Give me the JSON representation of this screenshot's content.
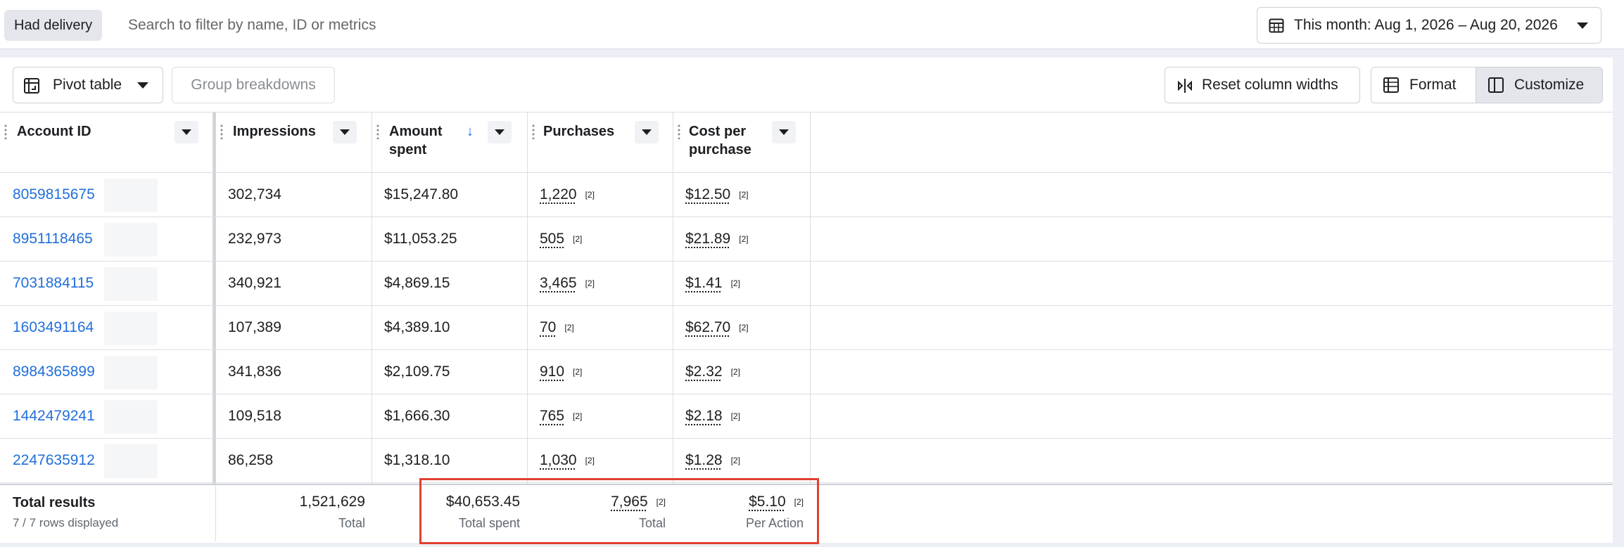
{
  "filter": {
    "chip_label": "Had delivery",
    "search_placeholder": "Search to filter by name, ID or metrics",
    "date_range": "This month: Aug 1, 2026 – Aug 20, 2026"
  },
  "toolbar": {
    "pivot_label": "Pivot table",
    "group_label": "Group breakdowns",
    "reset_label": "Reset column widths",
    "format_label": "Format",
    "customize_label": "Customize"
  },
  "table": {
    "columns": {
      "account_id": "Account ID",
      "impressions": "Impressions",
      "amount_spent_1": "Amount",
      "amount_spent_2": "spent",
      "purchases": "Purchases",
      "cost_1": "Cost per",
      "cost_2": "purchase",
      "sort_arrow": "↓"
    },
    "rows": [
      {
        "account": "8059815675",
        "impressions": "302,734",
        "spent": "$15,247.80",
        "purchases": "1,220",
        "p_fn": "[2]",
        "cost": "$12.50",
        "c_fn": "[2]"
      },
      {
        "account": "8951118465",
        "impressions": "232,973",
        "spent": "$11,053.25",
        "purchases": "505",
        "p_fn": "[2]",
        "cost": "$21.89",
        "c_fn": "[2]"
      },
      {
        "account": "7031884115",
        "impressions": "340,921",
        "spent": "$4,869.15",
        "purchases": "3,465",
        "p_fn": "[2]",
        "cost": "$1.41",
        "c_fn": "[2]"
      },
      {
        "account": "1603491164",
        "impressions": "107,389",
        "spent": "$4,389.10",
        "purchases": "70",
        "p_fn": "[2]",
        "cost": "$62.70",
        "c_fn": "[2]"
      },
      {
        "account": "8984365899",
        "impressions": "341,836",
        "spent": "$2,109.75",
        "purchases": "910",
        "p_fn": "[2]",
        "cost": "$2.32",
        "c_fn": "[2]"
      },
      {
        "account": "1442479241",
        "impressions": "109,518",
        "spent": "$1,666.30",
        "purchases": "765",
        "p_fn": "[2]",
        "cost": "$2.18",
        "c_fn": "[2]"
      },
      {
        "account": "2247635912",
        "impressions": "86,258",
        "spent": "$1,318.10",
        "purchases": "1,030",
        "p_fn": "[2]",
        "cost": "$1.28",
        "c_fn": "[2]"
      }
    ],
    "footer": {
      "label": "Total results",
      "sub": "7 / 7 rows displayed",
      "impressions": "1,521,629",
      "impressions_cap": "Total",
      "spent": "$40,653.45",
      "spent_cap": "Total spent",
      "purchases": "7,965",
      "purchases_fn": "[2]",
      "purchases_cap": "Total",
      "cost": "$5.10",
      "cost_fn": "[2]",
      "cost_cap": "Per Action"
    }
  },
  "colors": {
    "link": "#216fdb",
    "highlight": "#e0412f"
  }
}
